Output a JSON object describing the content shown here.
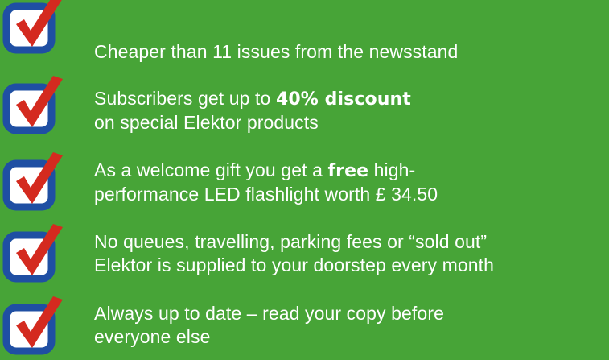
{
  "colors": {
    "background": "#47a437",
    "text": "#ffffff",
    "box_fill": "#ffffff",
    "box_border": "#1f4fa3",
    "check_mark": "#d42a1f"
  },
  "icons": {
    "check": "checkbox-checked-icon"
  },
  "benefits": [
    {
      "line1": "Cheaper than 11 issues from the newsstand",
      "line2": ""
    },
    {
      "line1_before": "Subscribers get up to ",
      "line1_bold": "40% discount",
      "line2": "on special Elektor products"
    },
    {
      "line1_before": "As a welcome gift you get a ",
      "line1_bold": "free",
      "line1_after": " high-",
      "line2": "performance LED flashlight worth £ 34.50"
    },
    {
      "line1": "No queues, travelling, parking fees or “sold out”",
      "line2": "Elektor is supplied to your doorstep every month"
    },
    {
      "line1": "Always up to date – read your copy before",
      "line2": "everyone else"
    }
  ]
}
